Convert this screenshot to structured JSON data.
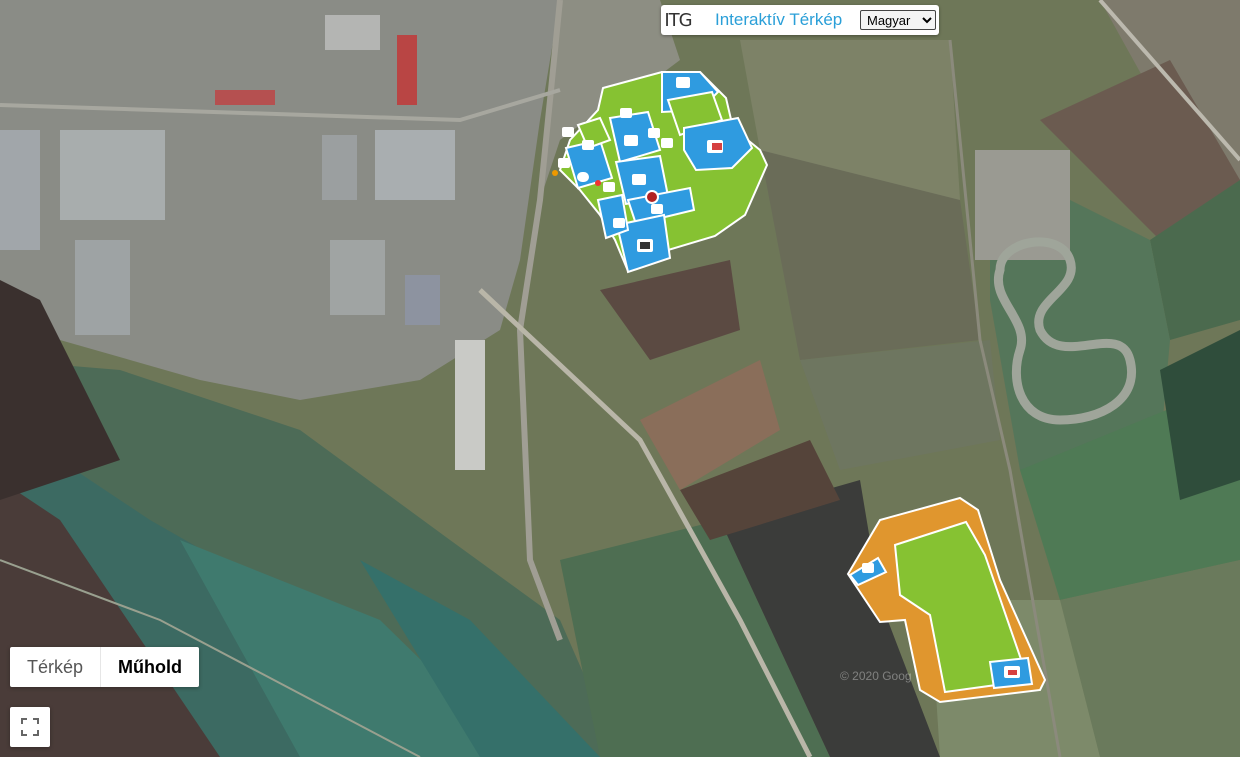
{
  "header": {
    "logo_text": "ITG",
    "title": "Interaktív Térkép",
    "language_selected": "Magyar",
    "language_options": [
      "Magyar"
    ]
  },
  "map_type": {
    "map_label": "Térkép",
    "satellite_label": "Műhold",
    "active": "Műhold"
  },
  "watermark": "© 2020 Goog",
  "colors": {
    "zone_green": "#86c232",
    "zone_blue": "#2f9be0",
    "zone_orange": "#e0962e",
    "title_blue": "#2a9fd8"
  },
  "icons": [
    "fullscreen-icon",
    "location-marker-icon",
    "building-icon",
    "restaurant-icon"
  ]
}
